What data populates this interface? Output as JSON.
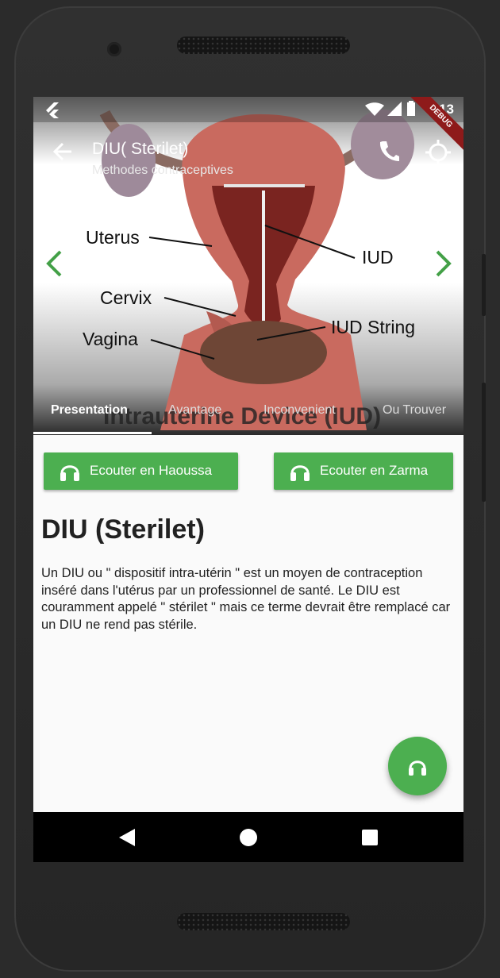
{
  "status_bar": {
    "time": "3:13",
    "debug_label": "DEBUG"
  },
  "app_bar": {
    "title": "DIU( Sterilet)",
    "subtitle": "Methodes contraceptives"
  },
  "hero": {
    "labels": {
      "uterus": "Uterus",
      "cervix": "Cervix",
      "vagina": "Vagina",
      "iud": "IUD",
      "iud_string": "IUD String"
    },
    "caption": "Intrauterine Device (IUD)"
  },
  "tabs": [
    {
      "label": "Presentation",
      "active": true
    },
    {
      "label": "Avantage",
      "active": false
    },
    {
      "label": "Inconvenient",
      "active": false
    },
    {
      "label": "Ou Trouver",
      "active": false
    }
  ],
  "audio_buttons": {
    "haoussa": "Ecouter en Haoussa",
    "zarma": "Ecouter en Zarma"
  },
  "content": {
    "heading": "DIU (Sterilet)",
    "body": "Un DIU ou \" dispositif intra-utérin \" est un moyen de contraception inséré dans l'utérus par un professionnel de santé. Le DIU est couramment appelé \" stérilet \" mais ce terme devrait être remplacé car un DIU ne rend pas stérile."
  },
  "colors": {
    "accent": "#4caf50",
    "nav_bar": "#000000",
    "debug_banner": "#8e1a1a"
  },
  "icons": [
    "back-arrow-icon",
    "phone-icon",
    "gps-crosshair-icon",
    "chevron-left-icon",
    "chevron-right-icon",
    "headphones-icon",
    "nav-back-icon",
    "nav-home-icon",
    "nav-recents-icon"
  ]
}
